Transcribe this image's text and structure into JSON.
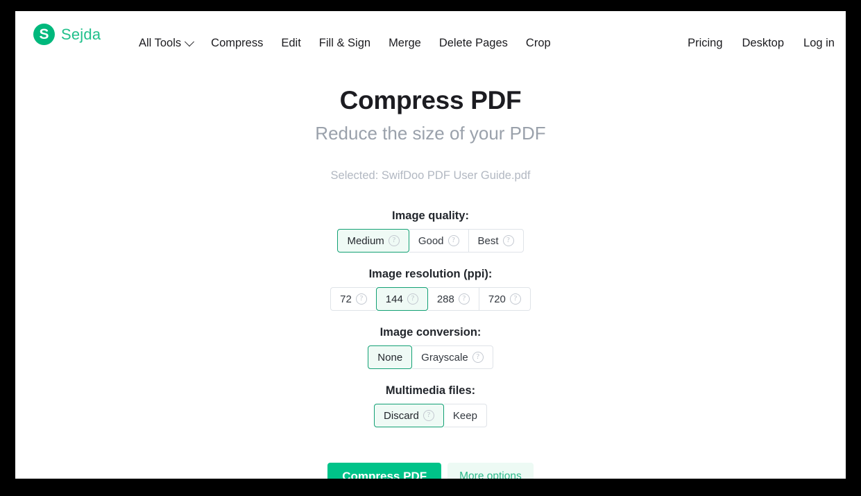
{
  "brand": {
    "logo_letter": "S",
    "name": "Sejda",
    "logo_color": "#00b87c",
    "name_color": "#21c08b"
  },
  "nav": {
    "left_items": [
      {
        "label": "All Tools",
        "has_chevron": true,
        "icon": "chevron-down-icon"
      },
      {
        "label": "Compress",
        "has_chevron": false
      },
      {
        "label": "Edit",
        "has_chevron": false
      },
      {
        "label": "Fill & Sign",
        "has_chevron": false
      },
      {
        "label": "Merge",
        "has_chevron": false
      },
      {
        "label": "Delete Pages",
        "has_chevron": false
      },
      {
        "label": "Crop",
        "has_chevron": false
      }
    ],
    "right_items": [
      {
        "label": "Pricing"
      },
      {
        "label": "Desktop"
      },
      {
        "label": "Log in"
      }
    ]
  },
  "main": {
    "title": "Compress PDF",
    "subtitle": "Reduce the size of your PDF",
    "selected_file": "Selected: SwifDoo PDF User Guide.pdf"
  },
  "options": [
    {
      "key": "image_quality",
      "label": "Image quality:",
      "selected": "Medium",
      "buttons": [
        {
          "label": "Medium",
          "help": true,
          "selected": true
        },
        {
          "label": "Good",
          "help": true,
          "selected": false
        },
        {
          "label": "Best",
          "help": true,
          "selected": false
        }
      ]
    },
    {
      "key": "image_resolution",
      "label": "Image resolution (ppi):",
      "selected": "144",
      "buttons": [
        {
          "label": "72",
          "help": true,
          "selected": false
        },
        {
          "label": "144",
          "help": true,
          "selected": true
        },
        {
          "label": "288",
          "help": true,
          "selected": false
        },
        {
          "label": "720",
          "help": true,
          "selected": false
        }
      ]
    },
    {
      "key": "image_conversion",
      "label": "Image conversion:",
      "selected": "None",
      "buttons": [
        {
          "label": "None",
          "help": false,
          "selected": true
        },
        {
          "label": "Grayscale",
          "help": true,
          "selected": false
        }
      ]
    },
    {
      "key": "multimedia_files",
      "label": "Multimedia files:",
      "selected": "Discard",
      "buttons": [
        {
          "label": "Discard",
          "help": true,
          "selected": true
        },
        {
          "label": "Keep",
          "help": false,
          "selected": false
        }
      ]
    }
  ],
  "actions": {
    "primary_label": "Compress PDF",
    "secondary_label": "More options",
    "primary_color": "#00c389",
    "secondary_text_color": "#2bb98a",
    "secondary_bg_color": "#edfaf4"
  },
  "icons": {
    "help": "?",
    "chevron_down": "chevron-down-icon"
  }
}
